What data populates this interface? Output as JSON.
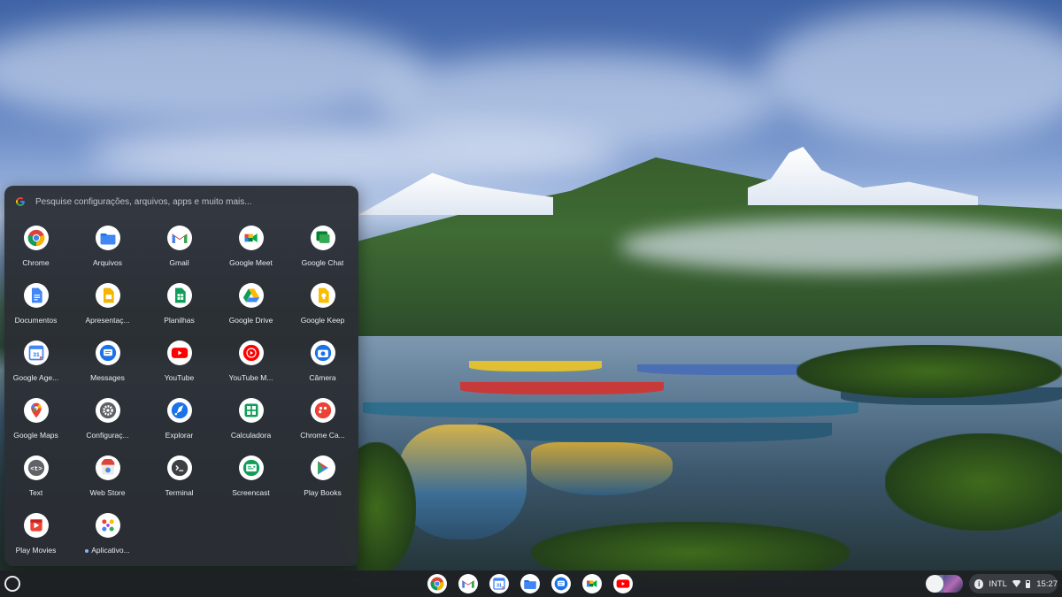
{
  "launcher": {
    "search_placeholder": "Pesquise configurações, arquivos, apps e muito mais...",
    "apps": [
      {
        "label": "Chrome",
        "icon": "chrome-icon"
      },
      {
        "label": "Arquivos",
        "icon": "files-icon"
      },
      {
        "label": "Gmail",
        "icon": "gmail-icon"
      },
      {
        "label": "Google Meet",
        "icon": "meet-icon"
      },
      {
        "label": "Google Chat",
        "icon": "chat-icon"
      },
      {
        "label": "Documentos",
        "icon": "docs-icon"
      },
      {
        "label": "Apresentaç...",
        "icon": "slides-icon"
      },
      {
        "label": "Planilhas",
        "icon": "sheets-icon"
      },
      {
        "label": "Google Drive",
        "icon": "drive-icon"
      },
      {
        "label": "Google Keep",
        "icon": "keep-icon"
      },
      {
        "label": "Google Age...",
        "icon": "calendar-icon"
      },
      {
        "label": "Messages",
        "icon": "messages-icon"
      },
      {
        "label": "YouTube",
        "icon": "youtube-icon"
      },
      {
        "label": "YouTube M...",
        "icon": "youtube-music-icon"
      },
      {
        "label": "Câmera",
        "icon": "camera-icon"
      },
      {
        "label": "Google Maps",
        "icon": "maps-icon"
      },
      {
        "label": "Configuraç...",
        "icon": "settings-icon"
      },
      {
        "label": "Explorar",
        "icon": "explore-icon"
      },
      {
        "label": "Calculadora",
        "icon": "calculator-icon"
      },
      {
        "label": "Chrome Ca...",
        "icon": "canvas-icon"
      },
      {
        "label": "Text",
        "icon": "text-icon"
      },
      {
        "label": "Web Store",
        "icon": "webstore-icon"
      },
      {
        "label": "Terminal",
        "icon": "terminal-icon"
      },
      {
        "label": "Screencast",
        "icon": "screencast-icon"
      },
      {
        "label": "Play Books",
        "icon": "play-books-icon"
      },
      {
        "label": "Play Movies",
        "icon": "play-movies-icon"
      },
      {
        "label": "Aplicativo...",
        "icon": "app-folder-icon",
        "new_dot": true
      }
    ]
  },
  "shelf": {
    "pinned": [
      {
        "icon": "chrome-icon"
      },
      {
        "icon": "gmail-icon"
      },
      {
        "icon": "calendar-icon"
      },
      {
        "icon": "files-icon"
      },
      {
        "icon": "messages-icon"
      },
      {
        "icon": "meet-icon"
      },
      {
        "icon": "youtube-icon"
      }
    ],
    "status": {
      "input_method": "INTL",
      "time": "15:27"
    }
  },
  "colors": {
    "panel_bg": "#2a2e34",
    "label_text": "#e8eaed",
    "accent": "#8ab4f8"
  }
}
